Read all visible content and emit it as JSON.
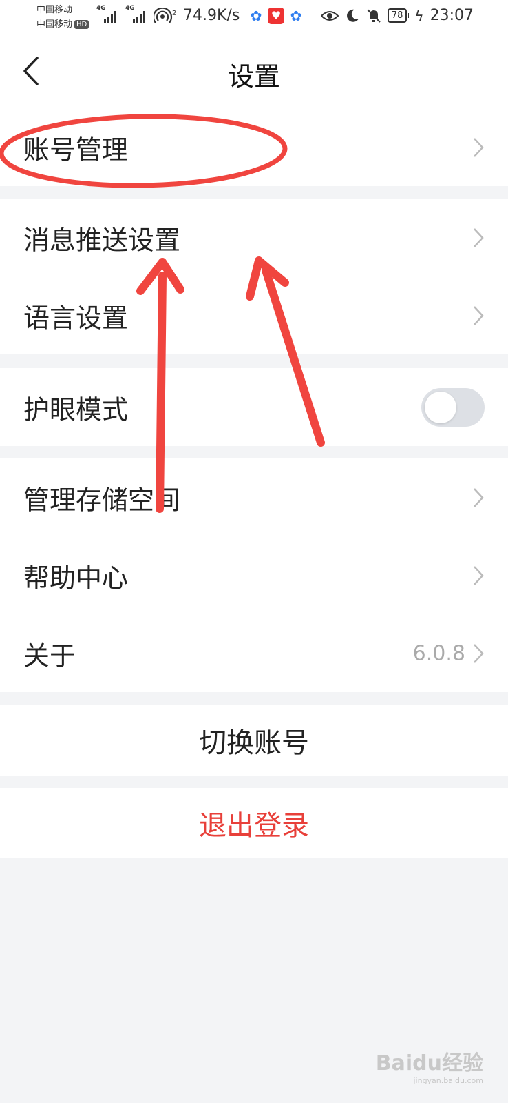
{
  "status_bar": {
    "carrier1": "中国移动",
    "carrier2": "中国移动",
    "hd_badge": "HD",
    "network1": "4G",
    "network2": "4G",
    "network_speed": "74.9K/s",
    "battery": "78",
    "time": "23:07",
    "icons": [
      "signal-icon",
      "signal-icon",
      "hotspot-icon",
      "app-paw-icon",
      "app-gift-icon",
      "app-paw-icon",
      "eye-icon",
      "moon-icon",
      "bell-off-icon",
      "charging-icon"
    ]
  },
  "header": {
    "title": "设置",
    "back_icon": "chevron-left-icon"
  },
  "settings": {
    "account": "账号管理",
    "push": "消息推送设置",
    "language": "语言设置",
    "eye_mode": "护眼模式",
    "eye_mode_on": false,
    "storage": "管理存储空间",
    "help": "帮助中心",
    "about": "关于",
    "version": "6.0.8"
  },
  "actions": {
    "switch_account": "切换账号",
    "logout": "退出登录"
  },
  "colors": {
    "accent_red": "#e8403a",
    "annotation_red": "#f0453f",
    "background": "#f3f4f6"
  },
  "watermark": {
    "text": "Baidu经验",
    "sub": "jingyan.baidu.com"
  }
}
